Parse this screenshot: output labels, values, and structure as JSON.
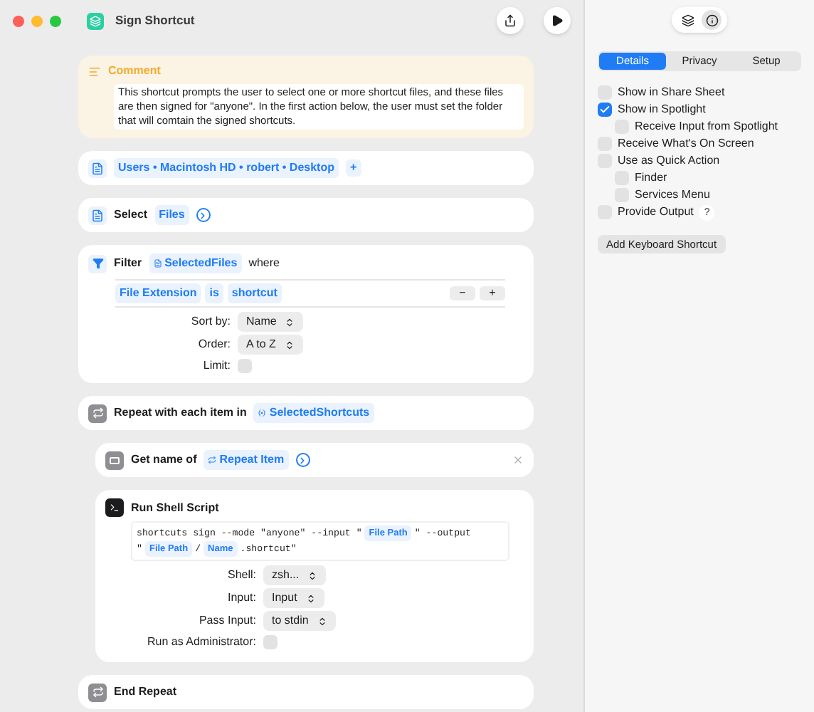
{
  "window": {
    "title": "Sign Shortcut"
  },
  "actions": [
    {
      "kind": "comment",
      "title": "Comment",
      "text": "This shortcut prompts the user to select one or more shortcut files, and these files are then signed for \"anyone\". In the first action below, the user must set the folder that will comtain the signed shortcuts."
    },
    {
      "kind": "path",
      "path": "Users • Macintosh HD • robert • Desktop",
      "plus": "+"
    },
    {
      "kind": "select",
      "label": "Select",
      "token": "Files"
    },
    {
      "kind": "filter",
      "label": "Filter",
      "variable": "SelectedFiles",
      "where": "where",
      "condition": [
        "File Extension",
        "is",
        "shortcut"
      ],
      "minus": "−",
      "plus": "+",
      "options": [
        {
          "label": "Sort by:",
          "value": "Name"
        },
        {
          "label": "Order:",
          "value": "A to Z"
        }
      ],
      "limit": {
        "label": "Limit:",
        "checked": false
      }
    },
    {
      "kind": "repeat",
      "label": "Repeat with each item in",
      "variable": "SelectedShortcuts",
      "children": [
        {
          "kind": "getname",
          "label": "Get name of",
          "variable": "Repeat Item"
        },
        {
          "kind": "shell",
          "title": "Run Shell Script",
          "script": [
            [
              {
                "kind": "text",
                "text": "shortcuts sign --mode \"anyone\" --input \""
              },
              {
                "kind": "token",
                "text": "File Path"
              },
              {
                "kind": "text",
                "text": "\" --output"
              }
            ],
            [
              {
                "kind": "text",
                "text": "\""
              },
              {
                "kind": "token",
                "text": "File Path"
              },
              {
                "kind": "text",
                "text": "/"
              },
              {
                "kind": "token",
                "text": "Name"
              },
              {
                "kind": "text",
                "text": ".shortcut\""
              }
            ]
          ],
          "options": [
            {
              "label": "Shell:",
              "value": "zsh..."
            },
            {
              "label": "Input:",
              "value": "Input"
            },
            {
              "label": "Pass Input:",
              "value": "to stdin"
            }
          ],
          "admin": {
            "label": "Run as Administrator:",
            "checked": false
          }
        }
      ],
      "end": "End Repeat"
    }
  ],
  "sidebar": {
    "tabs": [
      {
        "label": "Details",
        "selected": true
      },
      {
        "label": "Privacy",
        "selected": false
      },
      {
        "label": "Setup",
        "selected": false
      }
    ],
    "options": [
      {
        "label": "Show in Share Sheet",
        "checked": false
      },
      {
        "label": "Show in Spotlight",
        "checked": true,
        "children": [
          {
            "label": "Receive Input from Spotlight",
            "checked": false
          }
        ]
      },
      {
        "label": "Receive What's On Screen",
        "checked": false
      },
      {
        "label": "Use as Quick Action",
        "checked": false,
        "children": [
          {
            "label": "Finder",
            "checked": false
          },
          {
            "label": "Services Menu",
            "checked": false
          }
        ]
      },
      {
        "label": "Provide Output",
        "checked": false,
        "help": "?"
      }
    ],
    "button": "Add Keyboard Shortcut"
  }
}
